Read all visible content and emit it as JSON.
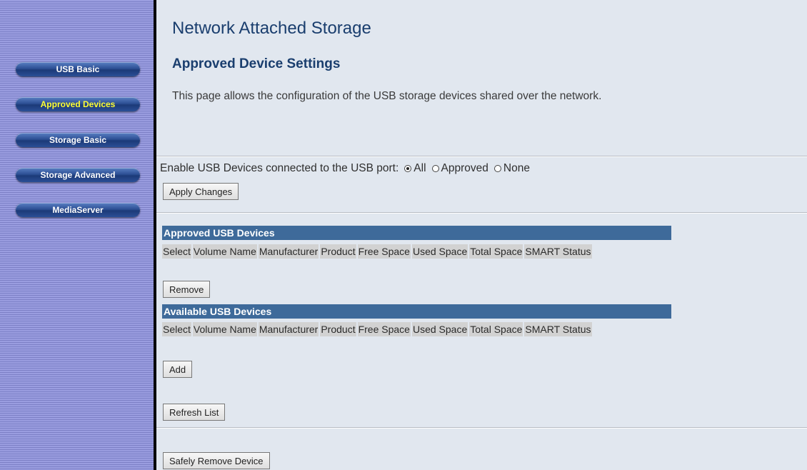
{
  "sidebar": {
    "items": [
      {
        "label": "USB Basic",
        "active": false
      },
      {
        "label": "Approved Devices",
        "active": true
      },
      {
        "label": "Storage Basic",
        "active": false
      },
      {
        "label": "Storage Advanced",
        "active": false
      },
      {
        "label": "MediaServer",
        "active": false
      }
    ]
  },
  "page": {
    "title": "Network Attached Storage",
    "section_title": "Approved Device Settings",
    "intro": "This page allows the configuration of the USB storage devices shared over the network."
  },
  "enable_usb": {
    "label": "Enable USB Devices connected to the USB port:",
    "options": [
      {
        "label": "All",
        "checked": true
      },
      {
        "label": "Approved",
        "checked": false
      },
      {
        "label": "None",
        "checked": false
      }
    ],
    "apply_label": "Apply Changes"
  },
  "approved_table": {
    "title": "Approved USB Devices",
    "columns": [
      "Select",
      "Volume Name",
      "Manufacturer",
      "Product",
      "Free Space",
      "Used Space",
      "Total Space",
      "SMART Status"
    ],
    "remove_label": "Remove"
  },
  "available_table": {
    "title": "Available USB Devices",
    "columns": [
      "Select",
      "Volume Name",
      "Manufacturer",
      "Product",
      "Free Space",
      "Used Space",
      "Total Space",
      "SMART Status"
    ],
    "add_label": "Add",
    "refresh_label": "Refresh List"
  },
  "safely_remove_label": "Safely Remove Device",
  "colors": {
    "main_bg": "#e1e7ef",
    "title_text": "#1a3e6e",
    "table_header_bg": "#3e6a9a",
    "active_nav_text": "#ffff33"
  }
}
